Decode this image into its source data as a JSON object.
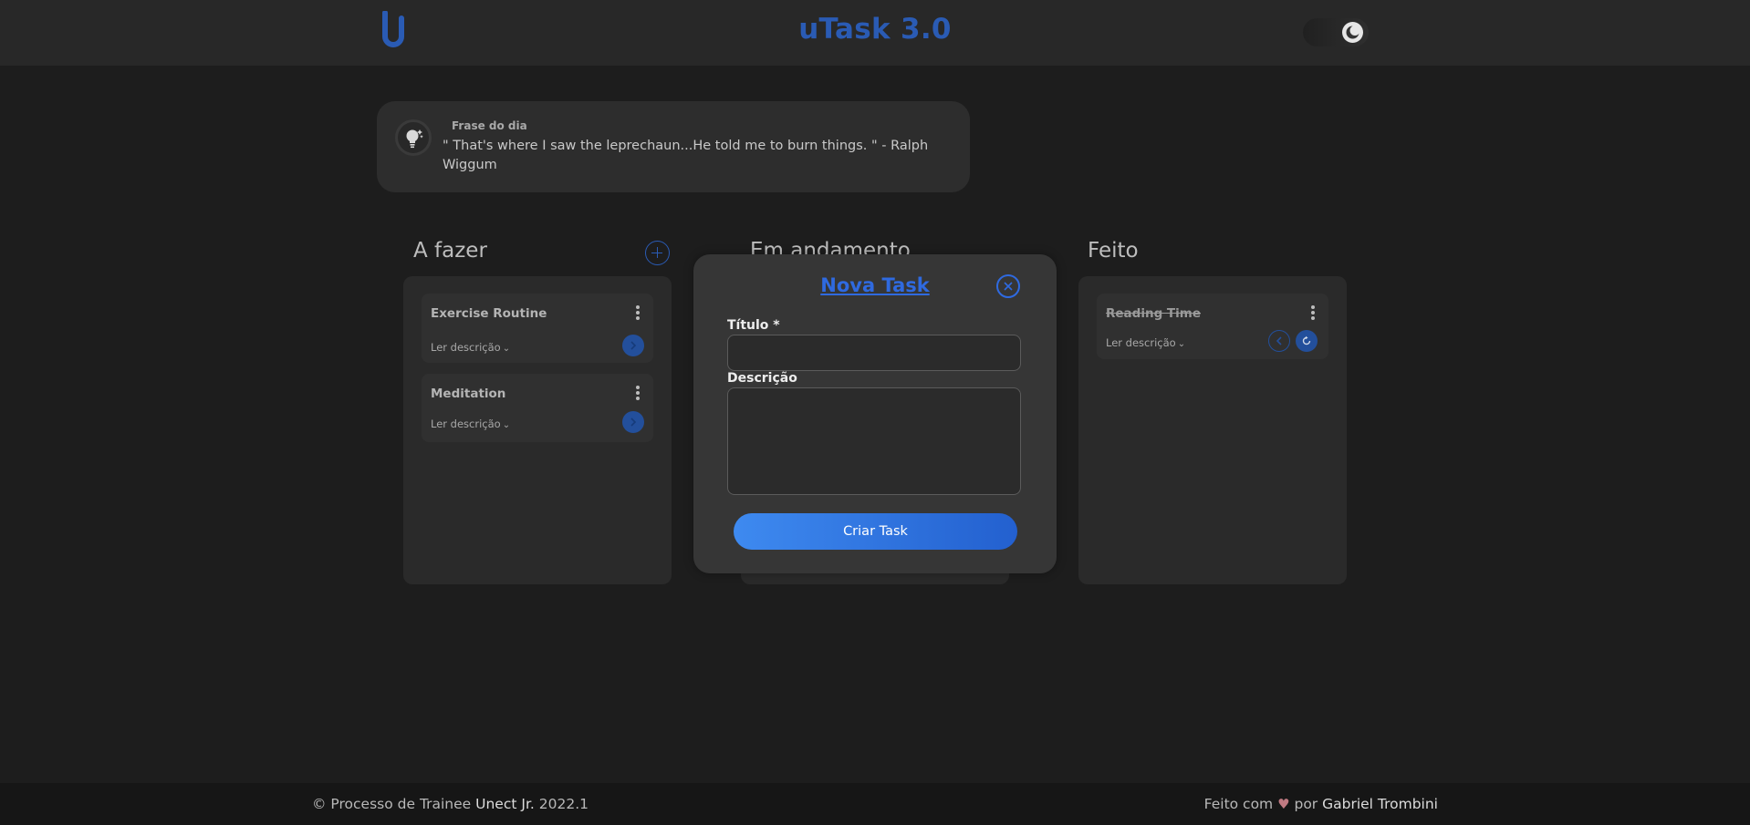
{
  "header": {
    "title": "uTask 3.0",
    "logo_icon": "utask-logo-icon",
    "theme_toggle_icon": "moon-icon",
    "accent_color": "#2a5bb4"
  },
  "quote": {
    "label": "Frase do dia",
    "text": "\" That's where I saw the leprechaun...He told me to burn things. \" - Ralph Wiggum",
    "icon": "lightbulb-icon"
  },
  "columns": [
    {
      "title": "A fazer",
      "tasks": [
        {
          "title": "Exercise Routine",
          "read_label": "Ler descrição"
        },
        {
          "title": "Meditation",
          "read_label": "Ler descrição"
        }
      ]
    },
    {
      "title": "Em andamento",
      "tasks": []
    },
    {
      "title": "Feito",
      "tasks": [
        {
          "title": "Reading Time",
          "read_label": "Ler descrição",
          "done": true
        }
      ]
    }
  ],
  "modal": {
    "title": "Nova Task",
    "title_label": "Título *",
    "title_value": "",
    "description_label": "Descrição",
    "description_value": "",
    "submit_label": "Criar Task"
  },
  "footer": {
    "left_prefix": "© Processo de Trainee ",
    "left_org": "Unect Jr.",
    "left_suffix": " 2022.1",
    "right_prefix": "Feito com ",
    "right_by": " por ",
    "right_author": "Gabriel Trombini"
  }
}
